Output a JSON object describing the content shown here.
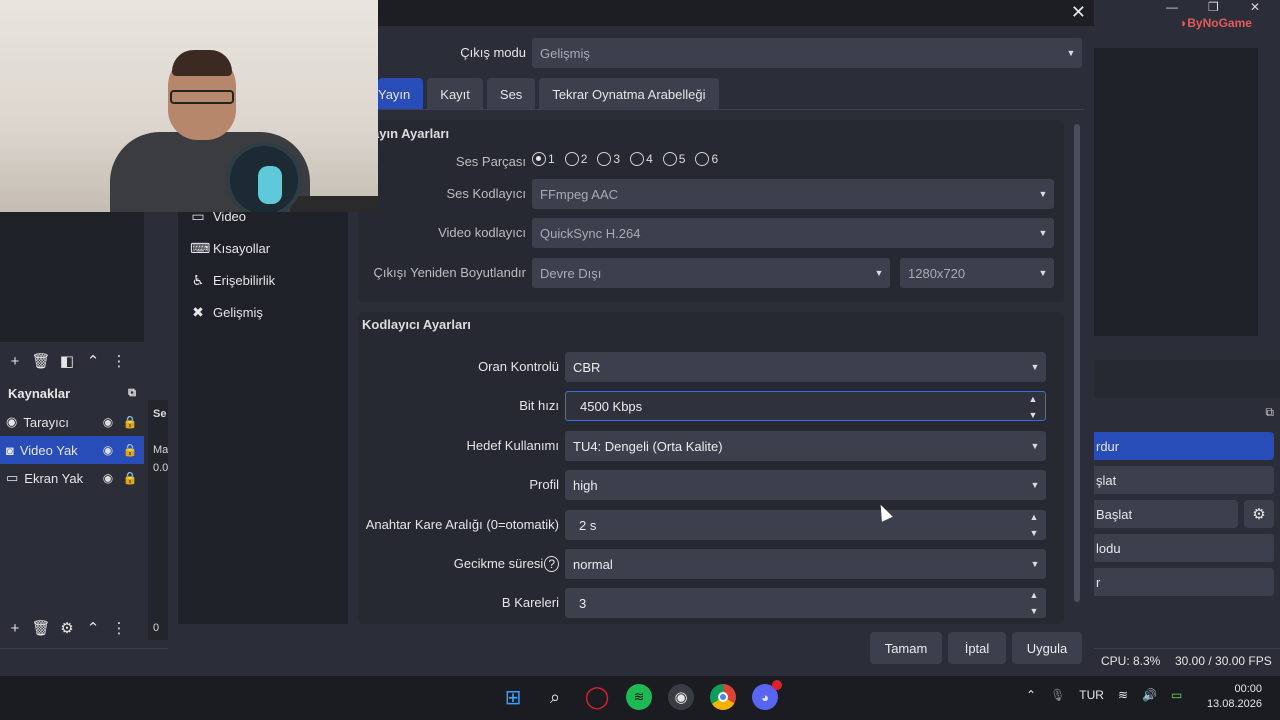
{
  "brand": {
    "name": "ByNoGame"
  },
  "dialog": {
    "output_mode_label": "Çıkış modu",
    "output_mode_value": "Gelişmiş",
    "tabs": [
      {
        "label": "Yayın",
        "active": true
      },
      {
        "label": "Kayıt",
        "active": false
      },
      {
        "label": "Ses",
        "active": false
      },
      {
        "label": "Tekrar Oynatma Arabelleği",
        "active": false
      }
    ],
    "stream_group_title": "ayın Ayarları",
    "audio_track_label": "Ses Parçası",
    "audio_tracks": [
      "1",
      "2",
      "3",
      "4",
      "5",
      "6"
    ],
    "audio_track_selected": "1",
    "audio_encoder_label": "Ses Kodlayıcı",
    "audio_encoder_value": "FFmpeg AAC",
    "video_encoder_label": "Video kodlayıcı",
    "video_encoder_value": "QuickSync H.264",
    "rescale_label": "Çıkışı Yeniden Boyutlandır",
    "rescale_value": "Devre Dışı",
    "rescale_resolution": "1280x720",
    "encoder_group_title": "Kodlayıcı Ayarları",
    "rate_control_label": "Oran Kontrolü",
    "rate_control_value": "CBR",
    "bitrate_label": "Bit hızı",
    "bitrate_value": "4500 Kbps",
    "target_usage_label": "Hedef Kullanımı",
    "target_usage_value": "TU4: Dengeli (Orta Kalite)",
    "profile_label": "Profil",
    "profile_value": "high",
    "keyframe_label": "Anahtar Kare Aralığı (0=otomatik)",
    "keyframe_value": "2 s",
    "latency_label": "Gecikme süresi",
    "latency_value": "normal",
    "bframes_label": "B Kareleri",
    "bframes_value": "3",
    "ok_label": "Tamam",
    "cancel_label": "İptal",
    "apply_label": "Uygula",
    "close_glyph": "✕"
  },
  "sidebar_nav": [
    {
      "label": "Video",
      "icon": "monitor-icon",
      "glyph": "▭"
    },
    {
      "label": "Kısayollar",
      "icon": "keyboard-icon",
      "glyph": "⌨"
    },
    {
      "label": "Erişebilirlik",
      "icon": "accessibility-icon",
      "glyph": "♿"
    },
    {
      "label": "Gelişmiş",
      "icon": "tools-icon",
      "glyph": "✖"
    }
  ],
  "obs": {
    "sources_title": "Kaynaklar",
    "sources": [
      {
        "label": "Tarayıcı",
        "icon": "globe-icon",
        "glyph": "◉",
        "selected": false
      },
      {
        "label": "Video Yak",
        "icon": "camera-icon",
        "glyph": "◙",
        "selected": true
      },
      {
        "label": "Ekran Yak",
        "icon": "display-icon",
        "glyph": "▭",
        "selected": false
      }
    ],
    "mixer_text_1": "Ma",
    "mixer_text_2": "0.0",
    "mixer_text_3": "0",
    "mixer_tab_text": "Se",
    "controls": [
      {
        "label": "rdur",
        "primary": true
      },
      {
        "label": "şlat",
        "primary": false
      },
      {
        "label": "Başlat",
        "primary": false
      },
      {
        "label": "lodu",
        "primary": false
      },
      {
        "label": "r",
        "primary": false
      }
    ],
    "cpu": "CPU: 8.3%",
    "fps": "30.00 / 30.00 FPS"
  },
  "taskbar": {
    "language": "TUR",
    "time": "00:00",
    "date": "13.08.2026"
  },
  "colors": {
    "accent": "#284cb8",
    "window_bg": "#2b2e38",
    "control_bg": "#3c404d"
  }
}
